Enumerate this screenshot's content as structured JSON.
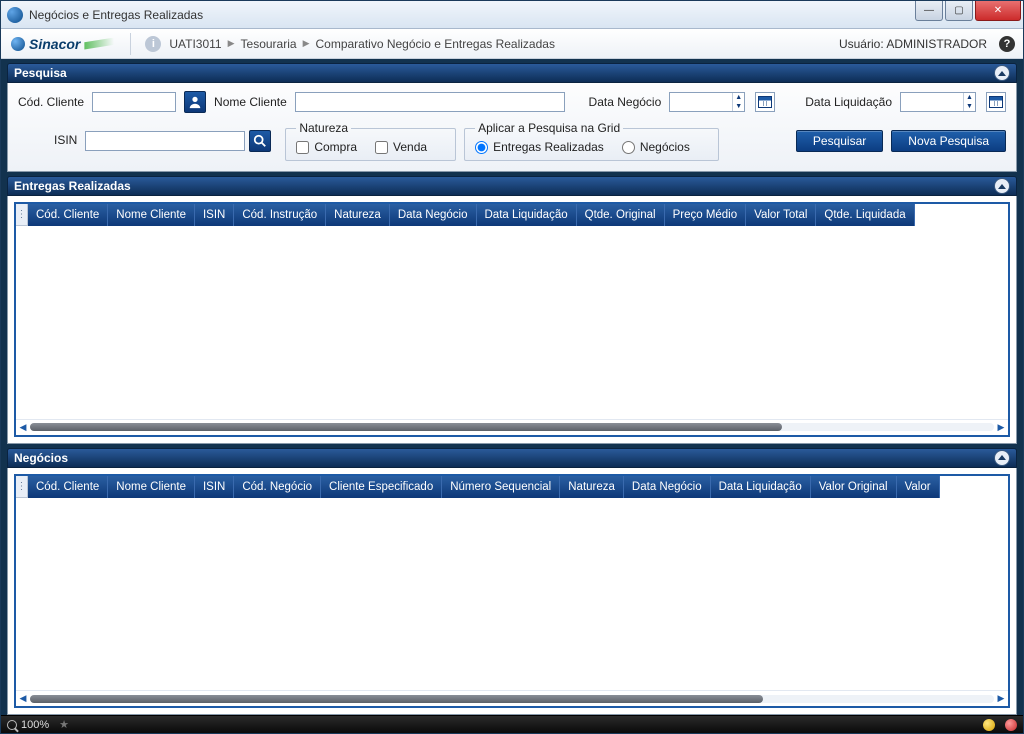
{
  "window": {
    "title": "Negócios e Entregas Realizadas"
  },
  "header": {
    "brand": "Sinacor",
    "breadcrumb": [
      "UATI3011",
      "Tesouraria",
      "Comparativo Negócio e Entregas Realizadas"
    ],
    "user_label": "Usuário: ADMINISTRADOR"
  },
  "search": {
    "title": "Pesquisa",
    "cod_cliente_label": "Cód. Cliente",
    "cod_cliente_value": "",
    "nome_cliente_label": "Nome Cliente",
    "nome_cliente_value": "",
    "data_negocio_label": "Data Negócio",
    "data_negocio_value": "",
    "data_liquidacao_label": "Data Liquidação",
    "data_liquidacao_value": "",
    "isin_label": "ISIN",
    "isin_value": "",
    "natureza": {
      "legend": "Natureza",
      "compra": "Compra",
      "compra_checked": false,
      "venda": "Venda",
      "venda_checked": false
    },
    "aplicar": {
      "legend": "Aplicar a Pesquisa na Grid",
      "entregas": "Entregas Realizadas",
      "negocios": "Negócios",
      "selected": "entregas"
    },
    "btn_pesquisar": "Pesquisar",
    "btn_nova": "Nova Pesquisa"
  },
  "entregas": {
    "title": "Entregas Realizadas",
    "columns": [
      "Cód. Cliente",
      "Nome Cliente",
      "ISIN",
      "Cód. Instrução",
      "Natureza",
      "Data Negócio",
      "Data Liquidação",
      "Qtde. Original",
      "Preço Médio",
      "Valor Total",
      "Qtde. Liquidada"
    ],
    "rows": []
  },
  "negocios": {
    "title": "Negócios",
    "columns": [
      "Cód. Cliente",
      "Nome Cliente",
      "ISIN",
      "Cód. Negócio",
      "Cliente Especificado",
      "Número Sequencial",
      "Natureza",
      "Data Negócio",
      "Data Liquidação",
      "Valor Original",
      "Valor"
    ],
    "rows": []
  },
  "status": {
    "zoom": "100%"
  }
}
